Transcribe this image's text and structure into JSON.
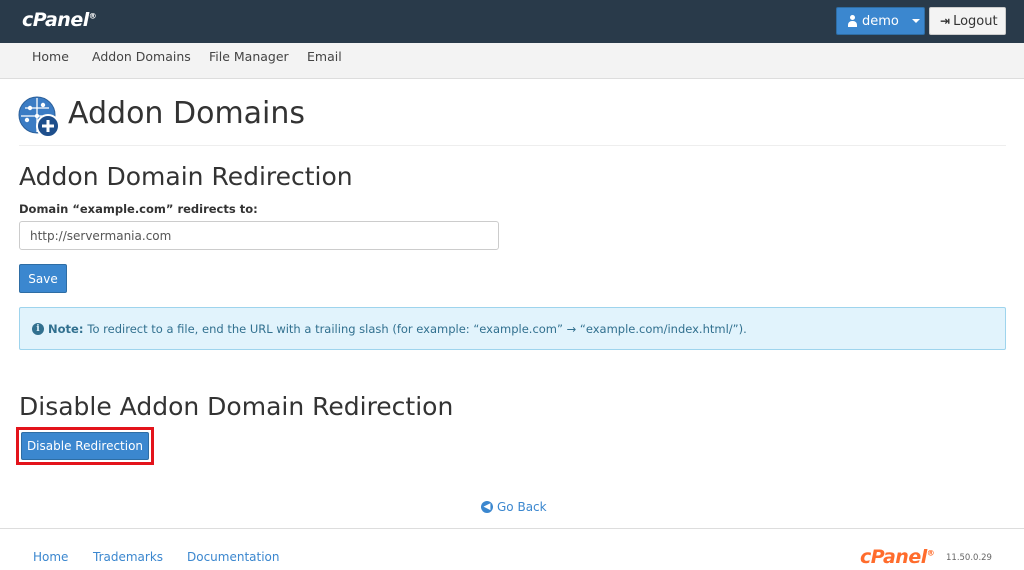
{
  "brand": {
    "logo_text": "cPanel",
    "registered": "®"
  },
  "topbar": {
    "user_label": "demo",
    "logout_label": "Logout"
  },
  "nav": {
    "items": [
      {
        "label": "Home"
      },
      {
        "label": "Addon Domains"
      },
      {
        "label": "File Manager"
      },
      {
        "label": "Email"
      }
    ]
  },
  "page": {
    "title": "Addon Domains",
    "icon": "addon-domains-globe-plus-icon"
  },
  "redirection": {
    "heading": "Addon Domain Redirection",
    "field_label": "Domain “example.com” redirects to:",
    "field_value": "http://servermania.com",
    "save_label": "Save"
  },
  "note": {
    "strong": "Note:",
    "text": "To redirect to a file, end the URL with a trailing slash (for example: “example.com” → “example.com/index.html/”)."
  },
  "disable": {
    "heading": "Disable Addon Domain Redirection",
    "button_label": "Disable Redirection"
  },
  "go_back_label": "Go Back",
  "footer": {
    "links": [
      {
        "label": "Home"
      },
      {
        "label": "Trademarks"
      },
      {
        "label": "Documentation"
      }
    ],
    "logo_text": "cPanel",
    "version": "11.50.0.29"
  },
  "colors": {
    "topbar_bg": "#293a4a",
    "primary": "#3b87cf",
    "highlight_outline": "#e3131b",
    "footer_logo": "#ff6c2c",
    "note_bg": "#e1f3fc"
  }
}
